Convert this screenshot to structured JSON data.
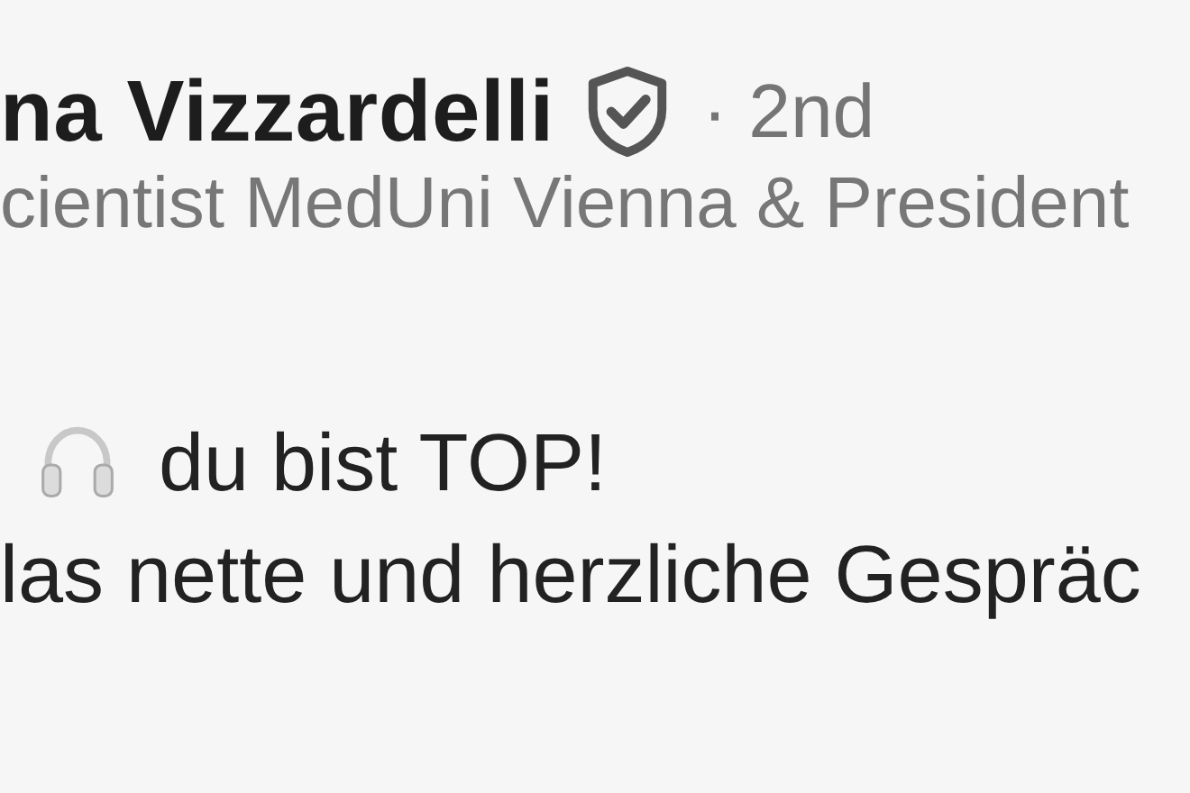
{
  "author": {
    "name": "na Vizzardelli",
    "verified": true,
    "degree": "· 2nd",
    "headline": "cientist MedUni Vienna & President"
  },
  "comment": {
    "lines": [
      {
        "text": "du bist TOP!",
        "emoji": true
      },
      {
        "text": "las nette und herzliche Gespräc",
        "emoji": false
      }
    ]
  }
}
